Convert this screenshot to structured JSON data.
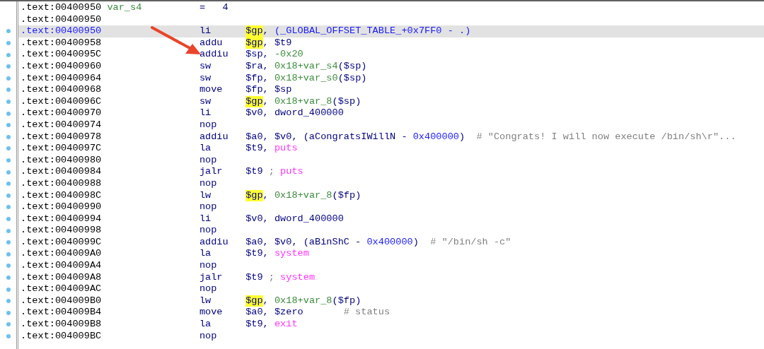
{
  "rows": [
    {
      "address": ".text:00400950",
      "label": "var_s4",
      "equate": "=   4",
      "dot": false,
      "selected": false
    },
    {
      "address": ".text:00400950",
      "dot": false,
      "selected": false
    },
    {
      "address": ".text:00400950",
      "mnemonic": "li",
      "operands": [
        {
          "text": "$gp",
          "kind": "hl"
        },
        {
          "text": ", ",
          "kind": "plain"
        },
        {
          "text": "(_GLOBAL_OFFSET_TABLE_+0x7FF0 - .)",
          "kind": "const"
        }
      ],
      "dot": true,
      "selected": true
    },
    {
      "address": ".text:00400958",
      "mnemonic": "addu",
      "operands": [
        {
          "text": "$gp",
          "kind": "hl"
        },
        {
          "text": ", $t9",
          "kind": "plain"
        }
      ],
      "dot": true,
      "selected": false
    },
    {
      "address": ".text:0040095C",
      "mnemonic": "addiu",
      "operands": [
        {
          "text": "$sp, ",
          "kind": "plain"
        },
        {
          "text": "-0x20",
          "kind": "var"
        }
      ],
      "dot": true,
      "selected": false
    },
    {
      "address": ".text:00400960",
      "mnemonic": "sw",
      "operands": [
        {
          "text": "$ra, ",
          "kind": "plain"
        },
        {
          "text": "0x18+var_s4",
          "kind": "var"
        },
        {
          "text": "($sp)",
          "kind": "plain"
        }
      ],
      "dot": true,
      "selected": false
    },
    {
      "address": ".text:00400964",
      "mnemonic": "sw",
      "operands": [
        {
          "text": "$fp, ",
          "kind": "plain"
        },
        {
          "text": "0x18+var_s0",
          "kind": "var"
        },
        {
          "text": "($sp)",
          "kind": "plain"
        }
      ],
      "dot": true,
      "selected": false
    },
    {
      "address": ".text:00400968",
      "mnemonic": "move",
      "operands": [
        {
          "text": "$fp, $sp",
          "kind": "plain"
        }
      ],
      "dot": true,
      "selected": false
    },
    {
      "address": ".text:0040096C",
      "mnemonic": "sw",
      "operands": [
        {
          "text": "$gp",
          "kind": "hl"
        },
        {
          "text": ", ",
          "kind": "plain"
        },
        {
          "text": "0x18+var_8",
          "kind": "var"
        },
        {
          "text": "($sp)",
          "kind": "plain"
        }
      ],
      "dot": true,
      "selected": false
    },
    {
      "address": ".text:00400970",
      "mnemonic": "li",
      "operands": [
        {
          "text": "$v0, dword_400000",
          "kind": "plain"
        }
      ],
      "dot": true,
      "selected": false
    },
    {
      "address": ".text:00400974",
      "mnemonic": "nop",
      "dot": true,
      "selected": false
    },
    {
      "address": ".text:00400978",
      "mnemonic": "addiu",
      "operands": [
        {
          "text": "$a0, $v0, (aCongratsIWillN - ",
          "kind": "plain"
        },
        {
          "text": "0x400000",
          "kind": "const"
        },
        {
          "text": ")",
          "kind": "plain"
        }
      ],
      "comment": "# \"Congrats! I will now execute /bin/sh\\r\"...",
      "dot": true,
      "selected": false
    },
    {
      "address": ".text:0040097C",
      "mnemonic": "la",
      "operands": [
        {
          "text": "$t9, ",
          "kind": "plain"
        },
        {
          "text": "puts",
          "kind": "func"
        }
      ],
      "dot": true,
      "selected": false
    },
    {
      "address": ".text:00400980",
      "mnemonic": "nop",
      "dot": true,
      "selected": false
    },
    {
      "address": ".text:00400984",
      "mnemonic": "jalr",
      "operands": [
        {
          "text": "$t9 ",
          "kind": "plain"
        },
        {
          "text": "; ",
          "kind": "comment"
        },
        {
          "text": "puts",
          "kind": "func"
        }
      ],
      "dot": true,
      "selected": false
    },
    {
      "address": ".text:00400988",
      "mnemonic": "nop",
      "dot": true,
      "selected": false
    },
    {
      "address": ".text:0040098C",
      "mnemonic": "lw",
      "operands": [
        {
          "text": "$gp",
          "kind": "hl"
        },
        {
          "text": ", ",
          "kind": "plain"
        },
        {
          "text": "0x18+var_8",
          "kind": "var"
        },
        {
          "text": "($fp)",
          "kind": "plain"
        }
      ],
      "dot": true,
      "selected": false
    },
    {
      "address": ".text:00400990",
      "mnemonic": "nop",
      "dot": true,
      "selected": false
    },
    {
      "address": ".text:00400994",
      "mnemonic": "li",
      "operands": [
        {
          "text": "$v0, dword_400000",
          "kind": "plain"
        }
      ],
      "dot": true,
      "selected": false
    },
    {
      "address": ".text:00400998",
      "mnemonic": "nop",
      "dot": true,
      "selected": false
    },
    {
      "address": ".text:0040099C",
      "mnemonic": "addiu",
      "operands": [
        {
          "text": "$a0, $v0, (aBinShC - ",
          "kind": "plain"
        },
        {
          "text": "0x400000",
          "kind": "const"
        },
        {
          "text": ")",
          "kind": "plain"
        }
      ],
      "comment": "# \"/bin/sh -c\"",
      "dot": true,
      "selected": false
    },
    {
      "address": ".text:004009A0",
      "mnemonic": "la",
      "operands": [
        {
          "text": "$t9, ",
          "kind": "plain"
        },
        {
          "text": "system",
          "kind": "func"
        }
      ],
      "dot": true,
      "selected": false
    },
    {
      "address": ".text:004009A4",
      "mnemonic": "nop",
      "dot": true,
      "selected": false
    },
    {
      "address": ".text:004009A8",
      "mnemonic": "jalr",
      "operands": [
        {
          "text": "$t9 ",
          "kind": "plain"
        },
        {
          "text": "; ",
          "kind": "comment"
        },
        {
          "text": "system",
          "kind": "func"
        }
      ],
      "dot": true,
      "selected": false
    },
    {
      "address": ".text:004009AC",
      "mnemonic": "nop",
      "dot": true,
      "selected": false
    },
    {
      "address": ".text:004009B0",
      "mnemonic": "lw",
      "operands": [
        {
          "text": "$gp",
          "kind": "hl"
        },
        {
          "text": ", ",
          "kind": "plain"
        },
        {
          "text": "0x18+var_8",
          "kind": "var"
        },
        {
          "text": "($fp)",
          "kind": "plain"
        }
      ],
      "dot": true,
      "selected": false
    },
    {
      "address": ".text:004009B4",
      "mnemonic": "move",
      "operands": [
        {
          "text": "$a0, $zero",
          "kind": "plain"
        }
      ],
      "comment": "# status",
      "dot": true,
      "selected": false
    },
    {
      "address": ".text:004009B8",
      "mnemonic": "la",
      "operands": [
        {
          "text": "$t9, ",
          "kind": "plain"
        },
        {
          "text": "exit",
          "kind": "func"
        }
      ],
      "dot": true,
      "selected": false
    },
    {
      "address": ".text:004009BC",
      "mnemonic": "nop",
      "dot": true,
      "selected": false
    }
  ]
}
